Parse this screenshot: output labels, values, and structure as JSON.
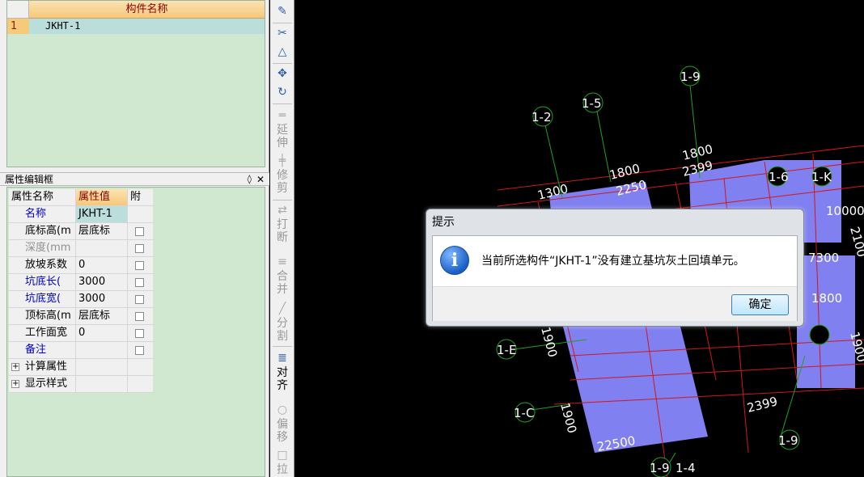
{
  "component_list": {
    "header": "构件名称",
    "rows": [
      {
        "num": "1",
        "name": "JKHT-1"
      }
    ]
  },
  "property_editor": {
    "title": "属性编辑框",
    "pin_icon": "pin-icon",
    "close_icon": "close-icon",
    "columns": [
      "属性名称",
      "属性值",
      "附"
    ],
    "rows": [
      {
        "name": "名称",
        "value": "JKHT-1",
        "style": "blue",
        "checkbox": false
      },
      {
        "name": "底标高(m",
        "value": "层底标",
        "style": "normal",
        "checkbox": true
      },
      {
        "name": "深度(mm",
        "value": "",
        "style": "gray",
        "checkbox": true
      },
      {
        "name": "放坡系数",
        "value": "0",
        "style": "normal",
        "checkbox": true
      },
      {
        "name": "坑底长(",
        "value": "3000",
        "style": "blue",
        "checkbox": true
      },
      {
        "name": "坑底宽(",
        "value": "3000",
        "style": "blue",
        "checkbox": true
      },
      {
        "name": "顶标高(m",
        "value": "层底标",
        "style": "normal",
        "checkbox": true
      },
      {
        "name": "工作面宽",
        "value": "0",
        "style": "normal",
        "checkbox": true
      },
      {
        "name": "备注",
        "value": "",
        "style": "blue",
        "checkbox": true
      }
    ],
    "groups": [
      "计算属性",
      "显示样式"
    ]
  },
  "toolbar": {
    "items": [
      {
        "icon": "pencil-icon"
      },
      {
        "icon": "copy-icon"
      },
      {
        "icon": "mirror-icon"
      },
      {
        "icon": "move-icon"
      },
      {
        "icon": "rotate-icon"
      },
      {
        "label": "延伸",
        "icon": "extend-icon",
        "enabled": false
      },
      {
        "label": "修剪",
        "icon": "trim-icon",
        "enabled": false
      },
      {
        "label": "打断",
        "icon": "break-icon",
        "enabled": false
      },
      {
        "label": "合并",
        "icon": "merge-icon",
        "enabled": false
      },
      {
        "label": "分割",
        "icon": "split-icon",
        "enabled": false
      },
      {
        "label": "对齐",
        "icon": "align-icon",
        "enabled": true
      },
      {
        "label": "偏移",
        "icon": "offset-icon",
        "enabled": false
      },
      {
        "label": "拉",
        "icon": "stretch-icon",
        "enabled": false
      }
    ]
  },
  "canvas": {
    "axis_labels": [
      "1-9",
      "1-5",
      "1-2",
      "1-E",
      "1-C",
      "1-9",
      "1-9",
      "1-4",
      "1-6",
      "1-K"
    ],
    "dimension_labels": [
      "1800",
      "2399",
      "1800",
      "2250",
      "1300",
      "1900",
      "22500",
      "2399",
      "10000",
      "2100",
      "7300",
      "1800",
      "1900",
      "1900"
    ]
  },
  "dialog": {
    "title": "提示",
    "icon": "info-icon",
    "message": "当前所选构件“JKHT-1”没有建立基坑灰土回填单元。",
    "ok_label": "确定"
  }
}
